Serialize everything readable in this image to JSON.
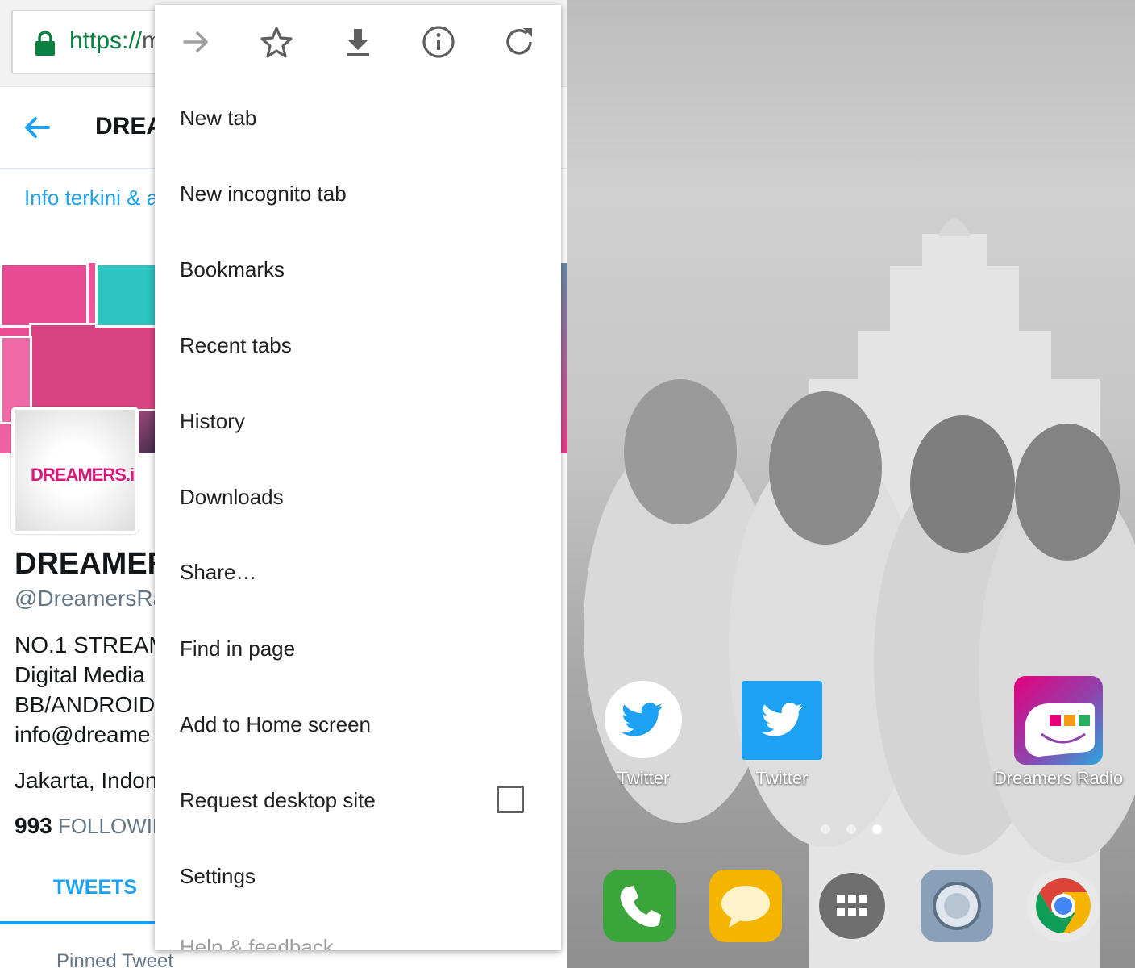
{
  "browser": {
    "url_scheme": "https://",
    "url_rest": "m"
  },
  "twitter": {
    "title": "DREA",
    "info": "Info terkini & a",
    "avatar_logo": "DREAMERS.id",
    "profile_name": "DREAMER",
    "handle": "@DreamersRa",
    "bio_lines": [
      "NO.1 STREAM",
      "Digital Media",
      "BB/ANDROID",
      "info@dreame"
    ],
    "location": "Jakarta, Indon",
    "following_count": "993",
    "following_label": "FOLLOWIN",
    "tab_tweets": "TWEETS",
    "pinned": "Pinned Tweet"
  },
  "menu": {
    "icons": [
      "forward-icon",
      "star-icon",
      "download-icon",
      "info-icon",
      "reload-icon"
    ],
    "items": [
      "New tab",
      "New incognito tab",
      "Bookmarks",
      "Recent tabs",
      "History",
      "Downloads",
      "Share…",
      "Find in page",
      "Add to Home screen",
      "Request desktop site",
      "Settings",
      "Help & feedback"
    ],
    "request_desktop_checked": false
  },
  "homescreen": {
    "apps": [
      {
        "label": "Twitter",
        "icon": "twitter-round-icon"
      },
      {
        "label": "Twitter",
        "icon": "twitter-square-icon"
      },
      {
        "label": "Dreamers Radio",
        "icon": "dreamers-radio-icon"
      }
    ],
    "page_indicator": {
      "pages": 3,
      "active": 3
    },
    "dock": [
      "phone-icon",
      "messaging-icon",
      "app-drawer-icon",
      "camera-icon",
      "chrome-icon"
    ]
  },
  "colors": {
    "twitter_blue": "#1da1f2",
    "secure_green": "#0b8043",
    "brand_pink": "#d81b7a"
  }
}
